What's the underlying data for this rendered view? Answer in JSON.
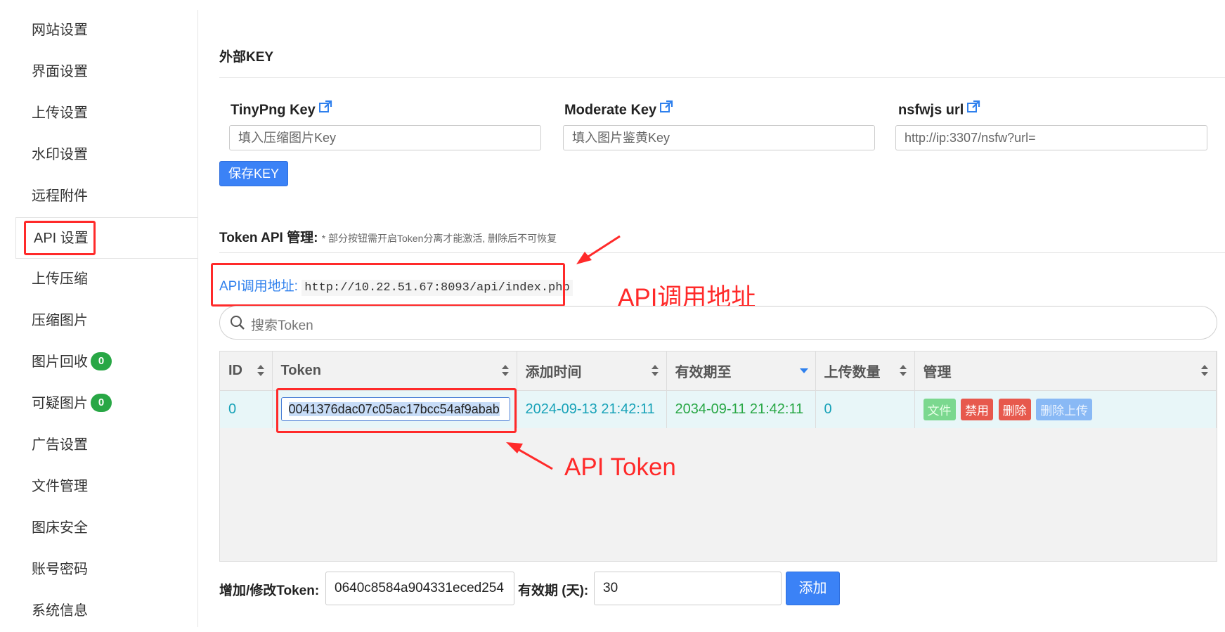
{
  "sidebar": {
    "items": [
      {
        "label": "网站设置"
      },
      {
        "label": "界面设置"
      },
      {
        "label": "上传设置"
      },
      {
        "label": "水印设置"
      },
      {
        "label": "远程附件"
      },
      {
        "label": "API 设置"
      },
      {
        "label": "上传压缩"
      },
      {
        "label": "压缩图片"
      },
      {
        "label": "图片回收",
        "badge": "0"
      },
      {
        "label": "可疑图片",
        "badge": "0"
      },
      {
        "label": "广告设置"
      },
      {
        "label": "文件管理"
      },
      {
        "label": "图床安全"
      },
      {
        "label": "账号密码"
      },
      {
        "label": "系统信息"
      }
    ]
  },
  "external_key": {
    "title": "外部KEY",
    "tinypng": {
      "label": "TinyPng Key",
      "placeholder": "填入压缩图片Key"
    },
    "moderate": {
      "label": "Moderate Key",
      "placeholder": "填入图片鉴黄Key"
    },
    "nsfwjs": {
      "label": "nsfwjs url",
      "value": "http://ip:3307/nsfw?url="
    },
    "save_button": "保存KEY"
  },
  "token_api": {
    "title": "Token API 管理:",
    "note": "* 部分按钮需开启Token分离才能激活, 删除后不可恢复",
    "url_label": "API调用地址:",
    "url": "http://10.22.51.67:8093/api/index.php",
    "search_placeholder": "搜索Token",
    "columns": [
      "ID",
      "Token",
      "添加时间",
      "有效期至",
      "上传数量",
      "管理"
    ],
    "rows": [
      {
        "id": "0",
        "token": "0041376dac07c05ac17bcc54af9abab",
        "added": "2024-09-13 21:42:11",
        "expires": "2034-09-11 21:42:11",
        "uploads": "0",
        "actions": [
          "文件",
          "禁用",
          "删除",
          "删除上传"
        ]
      }
    ]
  },
  "annotations": {
    "api_url": "API调用地址",
    "api_token": "API Token",
    "color": "#ff2a2a"
  },
  "token_form": {
    "token_label": "增加/修改Token:",
    "token_value": "0640c8584a904331eced254",
    "days_label": "有效期 (天):",
    "days_value": "30",
    "add_button": "添加"
  }
}
